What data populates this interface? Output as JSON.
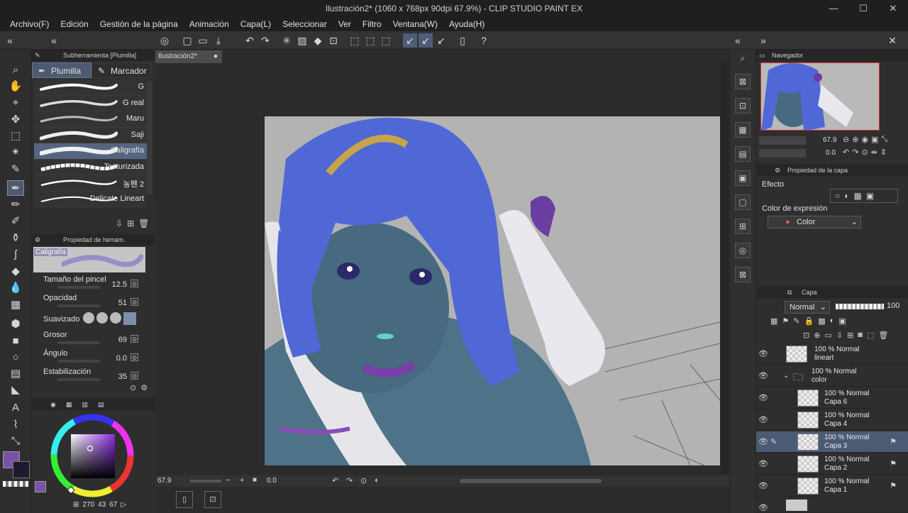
{
  "window": {
    "title": "Ilustración2* (1060 x 768px 90dpi 67.9%)  - CLIP STUDIO PAINT EX"
  },
  "menu": [
    "Archivo(F)",
    "Edición",
    "Gestión de la página",
    "Animación",
    "Capa(L)",
    "Seleccionar",
    "Ver",
    "Filtro",
    "Ventana(W)",
    "Ayuda(H)"
  ],
  "subtool": {
    "header": "Subherramienta [Plumilla]",
    "tabs": [
      "Plumilla",
      "Marcador"
    ],
    "brushes": [
      "G",
      "G real",
      "Maru",
      "Saji",
      "Caligrafía",
      "Texturizada",
      "농펜 2",
      "Delicate Lineart"
    ],
    "selected_index": 4
  },
  "tool_property": {
    "header": "Propiedad de herram.",
    "preview_name": "Caligrafía",
    "rows": [
      {
        "label": "Tamaño del pincel",
        "value": "12.5"
      },
      {
        "label": "Opacidad",
        "value": "51"
      },
      {
        "label": "Suavizado",
        "value": ""
      },
      {
        "label": "Grosor",
        "value": "69"
      },
      {
        "label": "Ángulo",
        "value": "0.0"
      },
      {
        "label": "Estabilización",
        "value": "35"
      }
    ]
  },
  "color": {
    "main": "#7a52a8",
    "sub": "#1e1a2e",
    "readout": {
      "h": "270",
      "s": "43",
      "v": "67"
    }
  },
  "document": {
    "tab": "Ilustración2*",
    "zoom": "67.9",
    "rotation": "0.0"
  },
  "navigator": {
    "header": "Navegador",
    "zoom": "67.9",
    "rotation": "0.0"
  },
  "layer_property": {
    "header": "Propiedad de la capa",
    "effect_label": "Efecto",
    "expression_label": "Color de expresión",
    "expression_value": "Color"
  },
  "layers": {
    "header": "Capa",
    "blend": "Normal",
    "opacity": "100",
    "items": [
      {
        "pct": "100 % Normal",
        "name": "lineart"
      },
      {
        "pct": "100 % Normal",
        "name": "color"
      },
      {
        "pct": "100 % Normal",
        "name": "Capa 6"
      },
      {
        "pct": "100 % Normal",
        "name": "Capa 4"
      },
      {
        "pct": "100 % Normal",
        "name": "Capa 3"
      },
      {
        "pct": "100 % Normal",
        "name": "Capa 2"
      },
      {
        "pct": "100 % Normal",
        "name": "Capa 1"
      }
    ],
    "selected_index": 4
  }
}
